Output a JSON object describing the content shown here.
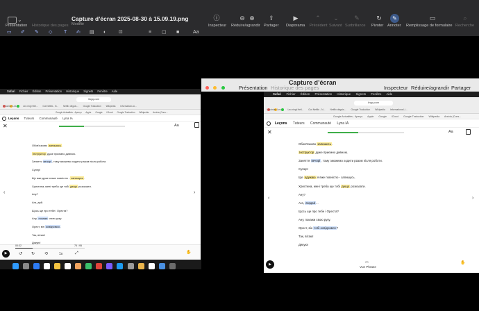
{
  "toolbar": {
    "labels": {
      "presentation": "Présentation",
      "history": "Historique des pages",
      "inspector": "Inspecteur",
      "zoom": "Réduire/agrandir",
      "share": "Partager",
      "slideshow": "Diaporama",
      "previous": "Précédent",
      "next": "Suivant",
      "highlight": "Surbrillance",
      "rotate": "Pivoter",
      "annotate": "Annoter",
      "fill_form": "Remplissage de formulaire",
      "search": "Recherche"
    },
    "doc_title": "Capture d’écran 2025-08-30 à 15.09.19.png",
    "doc_status": "Modifié",
    "font_label": "Aa"
  },
  "left": {
    "menubar": [
      "Safari",
      "Fichier",
      "Édition",
      "Présentation",
      "Historique",
      "Signets",
      "Fenêtre",
      "Aide"
    ],
    "url": "lingq.com",
    "tabs": [
      "Ukrainian Les...",
      "Leo ringt Hell...",
      "Gut Netflix - N...",
      "Netflix déguis...",
      "Google Traduction",
      "Wikipedia",
      "Informations Li..."
    ],
    "bookmarks": [
      "Google Actualités - Aperçu",
      "Apple",
      "Google",
      "iCloud",
      "Google Traduction",
      "Wikipedia",
      "Arxivia (Cons..."
    ],
    "appnav": [
      "Leçons",
      "Tuteurs",
      "Communauté",
      "Lyna IA"
    ],
    "lines": [
      {
        "pre": "Обов'язково ",
        "hl": "запишись",
        "hltype": "y",
        "post": "."
      },
      {
        "pre": "",
        "hl": "Інструктор",
        "hltype": "y",
        "post": " дуже приємно дивною."
      },
      {
        "pre": "Заняття ",
        "hl": "вечорі",
        "hltype": "b",
        "post": ", тому зможемо ходити разом після роботи."
      },
      {
        "pre": "Супер!",
        "hl": "",
        "hltype": "",
        "post": ""
      },
      {
        "pre": "Ще вже дуже я вже повністю - ",
        "hl": "запишусь",
        "hltype": "y",
        "post": "."
      },
      {
        "pre": "Христина, мені треба ще тобі ",
        "hl": "дещо",
        "hltype": "y",
        "post": " розказати."
      },
      {
        "pre": "Ану?",
        "hl": "",
        "hltype": "",
        "post": ""
      },
      {
        "pre": "Ага, дай.",
        "hl": "",
        "hltype": "",
        "post": ""
      },
      {
        "pre": "Щось ще про тебе і Ореста?",
        "hl": "",
        "hltype": "",
        "post": ""
      },
      {
        "pre": "Ану, ",
        "hl": "покажи",
        "hltype": "b",
        "post": " свою руку."
      },
      {
        "pre": "Орест, він ",
        "hl": "освідчився",
        "hltype": "b",
        "post": "."
      },
      {
        "pre": "Так, вітаю!",
        "hl": "",
        "hltype": "",
        "post": ""
      },
      {
        "pre": "Дякую!",
        "hl": "",
        "hltype": "",
        "post": ""
      }
    ],
    "player": {
      "time_start": "00:32",
      "time_end": "75 / 95",
      "speed": "1x",
      "progress": 0.25
    }
  },
  "right": {
    "menubar": [
      "Safari",
      "Fichier",
      "Édition",
      "Présentation",
      "Historique",
      "Signets",
      "Fenêtre",
      "Aide"
    ],
    "preview_title": "Capture d’écran",
    "preview_labels": {
      "presentation": "Présentation",
      "history": "Historique des pages",
      "inspector": "Inspecteur",
      "zoom": "Réduire/agrandir",
      "share": "Partager"
    },
    "url": "lingq.com",
    "tabs": [
      "Ukrainian Les...",
      "Leo ringt Hell...",
      "Gut Netflix - N...",
      "Netflix déguis...",
      "Google Traduction",
      "Wikipedia",
      "Informations Li..."
    ],
    "bookmarks": [
      "Google Actualités - Aperçu",
      "Apple",
      "Google",
      "iCloud",
      "Google Traduction",
      "Wikipedia",
      "Arxivia (Cons..."
    ],
    "appnav": [
      "Leçons",
      "Tuteurs",
      "Communauté",
      "Lyna IA"
    ],
    "lines": [
      {
        "pre": "Обов'язково ",
        "hl": "запишись",
        "hltype": "y",
        "post": "."
      },
      {
        "pre": "",
        "hl": "Інструктор",
        "hltype": "y",
        "post": " дуже приємно дивною."
      },
      {
        "pre": "Заняття ",
        "hl": "вечорі",
        "hltype": "b",
        "post": ", тому зможемо ходити разом після роботи."
      },
      {
        "pre": "Супер!",
        "hl": "",
        "hltype": "",
        "post": ""
      },
      {
        "pre": "Ще ",
        "hl": "одужаю",
        "hltype": "y",
        "post": " я вже повністю - запишусь."
      },
      {
        "pre": "Христина, мені треба ще тобі ",
        "hl": "дещо",
        "hltype": "y",
        "post": " розказати."
      },
      {
        "pre": "Ану?",
        "hl": "",
        "hltype": "",
        "post": ""
      },
      {
        "pre": "Ага, ",
        "hl": "вгадай",
        "hltype": "b",
        "post": "..."
      },
      {
        "pre": "Щось ще про тебе і Ореста?",
        "hl": "",
        "hltype": "",
        "post": ""
      },
      {
        "pre": "Ану, покажи свою руку.",
        "hl": "",
        "hltype": "",
        "post": ""
      },
      {
        "pre": "Орест, він ",
        "hl": "тобі освідчився",
        "hltype": "b",
        "post": "?"
      },
      {
        "pre": "Так, вітаю!",
        "hl": "",
        "hltype": "",
        "post": ""
      },
      {
        "pre": "Дякую!",
        "hl": "",
        "hltype": "",
        "post": ""
      }
    ],
    "phrase_label": "Vue Phrase",
    "aa_label": "Aa"
  }
}
